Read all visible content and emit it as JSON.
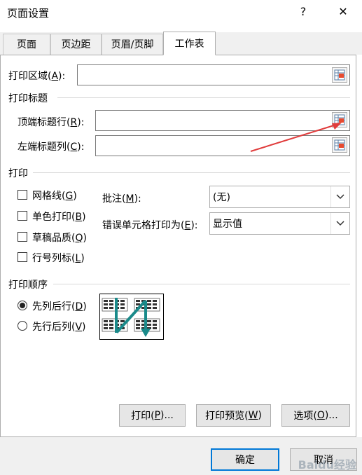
{
  "window": {
    "title": "页面设置",
    "help_label": "?",
    "close_label": "✕"
  },
  "tabs": [
    {
      "label": "页面"
    },
    {
      "label": "页边距"
    },
    {
      "label": "页眉/页脚"
    },
    {
      "label": "工作表"
    }
  ],
  "print_area": {
    "label_pre": "打印区域(",
    "label_key": "A",
    "label_post": "):",
    "value": ""
  },
  "print_titles": {
    "heading": "打印标题",
    "rows_label_pre": "顶端标题行(",
    "rows_label_key": "R",
    "rows_label_post": "):",
    "rows_value": "",
    "cols_label_pre": "左端标题列(",
    "cols_label_key": "C",
    "cols_label_post": "):",
    "cols_value": ""
  },
  "print": {
    "heading": "打印",
    "gridlines": {
      "pre": "网格线(",
      "key": "G",
      "post": ")",
      "checked": false
    },
    "mono": {
      "pre": "单色打印(",
      "key": "B",
      "post": ")",
      "checked": false
    },
    "draft": {
      "pre": "草稿品质(",
      "key": "Q",
      "post": ")",
      "checked": false
    },
    "headings": {
      "pre": "行号列标(",
      "key": "L",
      "post": ")",
      "checked": false
    },
    "comments_label_pre": "批注(",
    "comments_label_key": "M",
    "comments_label_post": "):",
    "comments_value": "(无)",
    "errors_label_pre": "错误单元格打印为(",
    "errors_label_key": "E",
    "errors_label_post": "):",
    "errors_value": "显示值"
  },
  "page_order": {
    "heading": "打印顺序",
    "down_then_over": {
      "pre": "先列后行(",
      "key": "D",
      "post": ")",
      "selected": true
    },
    "over_then_down": {
      "pre": "先行后列(",
      "key": "V",
      "post": ")",
      "selected": false
    }
  },
  "buttons": {
    "print": {
      "pre": "打印(",
      "key": "P",
      "post": ")..."
    },
    "preview": {
      "pre": "打印预览(",
      "key": "W",
      "post": ")"
    },
    "options": {
      "pre": "选项(",
      "key": "O",
      "post": ")..."
    },
    "ok": "确定",
    "cancel": "取消"
  },
  "colors": {
    "accent": "#0078d7",
    "annotation_arrow": "#e03c3c",
    "preview_arrow": "#1a8a8a"
  },
  "watermark": "Baidu经验"
}
